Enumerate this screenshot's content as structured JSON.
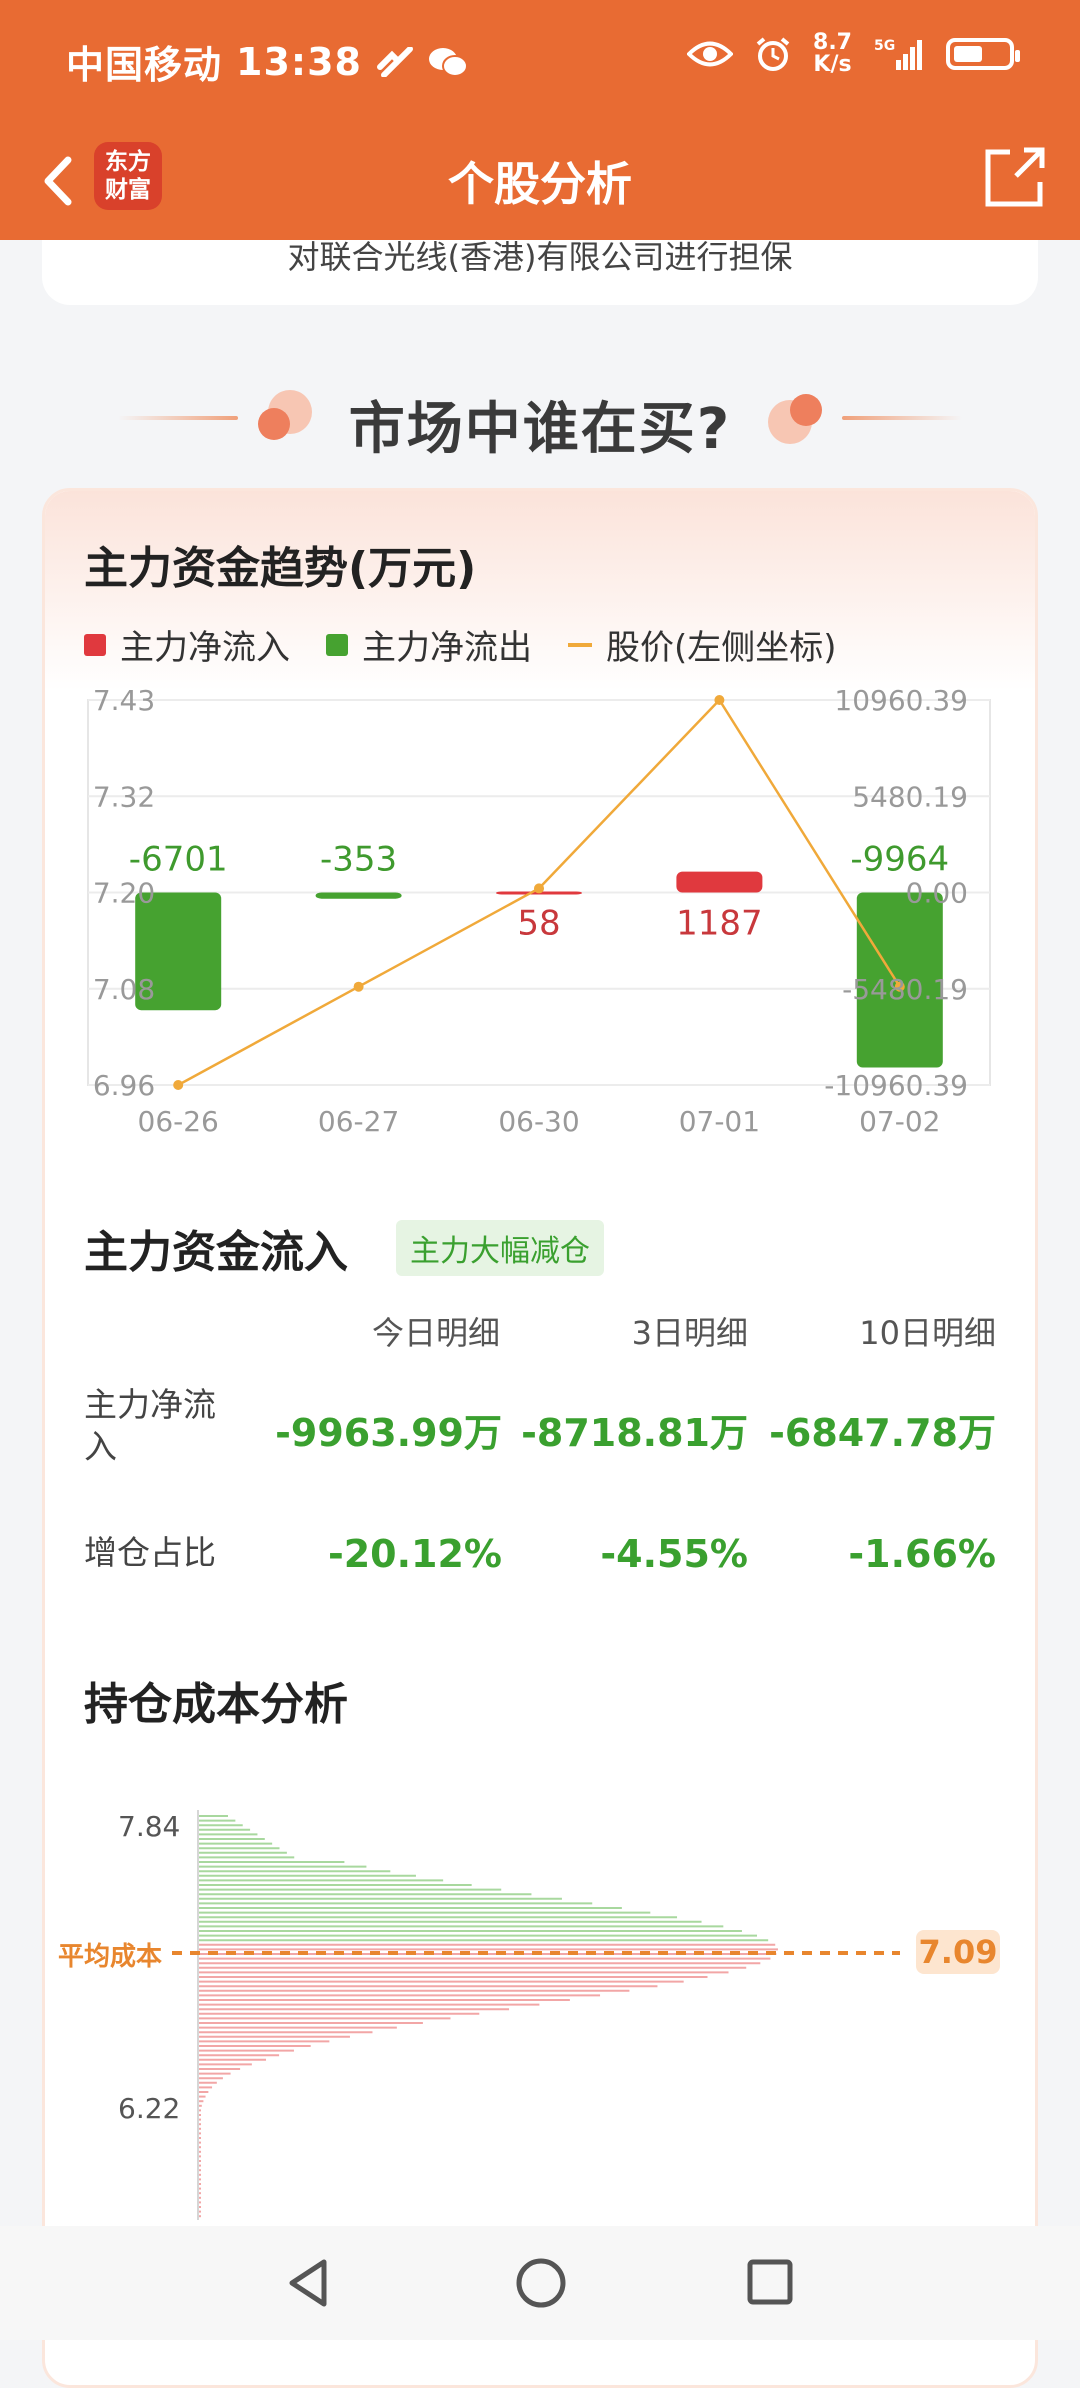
{
  "status_bar": {
    "carrier": "中国移动",
    "time": "13:38",
    "net_speed_top": "8.7",
    "net_speed_unit": "K/s",
    "network": "5G"
  },
  "header": {
    "title": "个股分析",
    "logo_line1": "东方",
    "logo_line2": "财富"
  },
  "top_card": {
    "snippet": "对联合光线(香港)有限公司进行担保"
  },
  "section": {
    "title": "市场中谁在买?"
  },
  "trend": {
    "title": "主力资金趋势(万元)",
    "legend": {
      "inflow": "主力净流入",
      "outflow": "主力净流出",
      "price": "股价(左侧坐标)"
    }
  },
  "colors": {
    "inflow": "#e0393e",
    "outflow": "#46a230",
    "price": "#f0a93a",
    "accent": "#e86b33"
  },
  "chart_data": {
    "type": "bar",
    "categories": [
      "06-26",
      "06-27",
      "06-30",
      "07-01",
      "07-02"
    ],
    "series": [
      {
        "name": "主力净流入/流出",
        "values": [
          -6701,
          -353,
          58,
          1187,
          -9964
        ],
        "axis": "right"
      },
      {
        "name": "股价(左侧坐标)",
        "type": "line",
        "values": [
          6.96,
          7.08,
          7.2,
          7.43,
          7.08
        ],
        "axis": "left"
      }
    ],
    "data_labels": [
      "-6701",
      "-353",
      "58",
      "1187",
      "-9964"
    ],
    "left_ticks": [
      "7.43",
      "7.32",
      "7.20",
      "7.08",
      "6.96"
    ],
    "right_ticks": [
      "10960.39",
      "5480.19",
      "0.00",
      "-5480.19",
      "-10960.39"
    ],
    "left_range": [
      6.96,
      7.43
    ],
    "right_range": [
      -10960.39,
      10960.39
    ]
  },
  "flow": {
    "title": "主力资金流入",
    "tag": "主力大幅减仓",
    "columns": [
      "今日明细",
      "3日明细",
      "10日明细"
    ],
    "rows": [
      {
        "label": "主力净流入",
        "values": [
          "-9963.99万",
          "-8718.81万",
          "-6847.78万"
        ]
      },
      {
        "label": "增仓占比",
        "values": [
          "-20.12%",
          "-4.55%",
          "-1.66%"
        ]
      }
    ]
  },
  "cost": {
    "title": "持仓成本分析",
    "price_high": "7.84",
    "price_low": "6.22",
    "avg_label": "平均成本",
    "avg_value": "7.09"
  }
}
